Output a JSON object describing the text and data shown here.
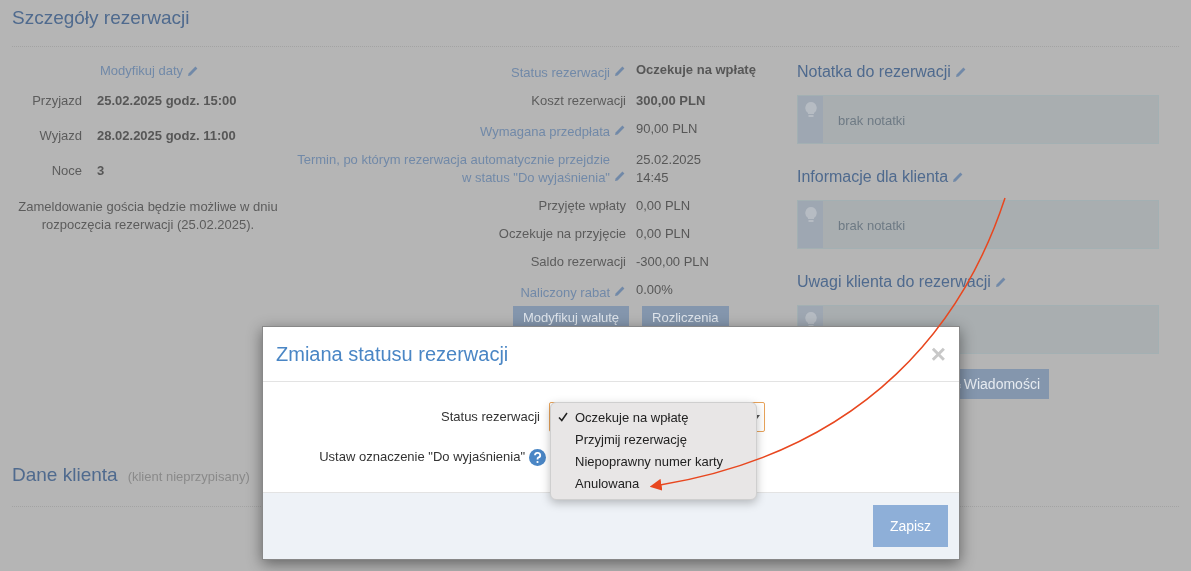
{
  "page": {
    "title": "Szczegóły rezerwacji",
    "dates": {
      "modify_link": "Modyfikuj daty",
      "rows": [
        {
          "label": "Przyjazd",
          "value": "25.02.2025 godz. 15:00"
        },
        {
          "label": "Wyjazd",
          "value": "28.02.2025 godz. 11:00"
        },
        {
          "label": "Noce",
          "value": "3"
        }
      ],
      "note": "Zameldowanie gościa będzie możliwe w dniu rozpoczęcia rezerwacji (25.02.2025)."
    },
    "summary": {
      "rows": [
        {
          "kind": "link",
          "label": "Status rezerwacji",
          "value": "Oczekuje na wpłatę",
          "bold": true
        },
        {
          "kind": "plain",
          "label": "Koszt rezerwacji",
          "value": "300,00 PLN",
          "bold": true
        },
        {
          "kind": "link",
          "label": "Wymagana przedpłata",
          "value": "90,00 PLN",
          "bold": false
        },
        {
          "kind": "link",
          "label": "Termin, po którym rezerwacja automatycznie przejdzie\nw status \"Do wyjaśnienia\"",
          "value": "25.02.2025\n14:45",
          "bold": false
        },
        {
          "kind": "plain",
          "label": "Przyjęte wpłaty",
          "value": "0,00 PLN",
          "bold": false
        },
        {
          "kind": "plain",
          "label": "Oczekuje na przyjęcie",
          "value": "0,00 PLN",
          "bold": false
        },
        {
          "kind": "plain",
          "label": "Saldo rezerwacji",
          "value": "-300,00 PLN",
          "bold": false
        },
        {
          "kind": "link",
          "label": "Naliczony rabat",
          "value": "0.00%",
          "bold": false
        }
      ],
      "buttons": [
        "Modyfikuj walutę",
        "Rozliczenia"
      ]
    },
    "notes": [
      {
        "heading": "Notatka do rezerwacji",
        "text": "brak notatki"
      },
      {
        "heading": "Informacje dla klienta",
        "text": "brak notatki"
      },
      {
        "heading": "Uwagi klienta do rezerwacji"
      }
    ],
    "messages_button": "Wiadomości",
    "client": {
      "title": "Dane klienta",
      "subtitle": "(klient nieprzypisany)"
    }
  },
  "modal": {
    "title": "Zmiana statusu rezerwacji",
    "close": "×",
    "status_label": "Status rezerwacji",
    "options": [
      {
        "label": "Oczekuje na wpłatę",
        "selected": true
      },
      {
        "label": "Przyjmij rezerwację",
        "selected": false
      },
      {
        "label": "Niepoprawny numer karty",
        "selected": false
      },
      {
        "label": "Anulowana",
        "selected": false
      }
    ],
    "flag_label": "Ustaw oznaczenie \"Do wyjaśnienia\"",
    "save": "Zapisz"
  }
}
